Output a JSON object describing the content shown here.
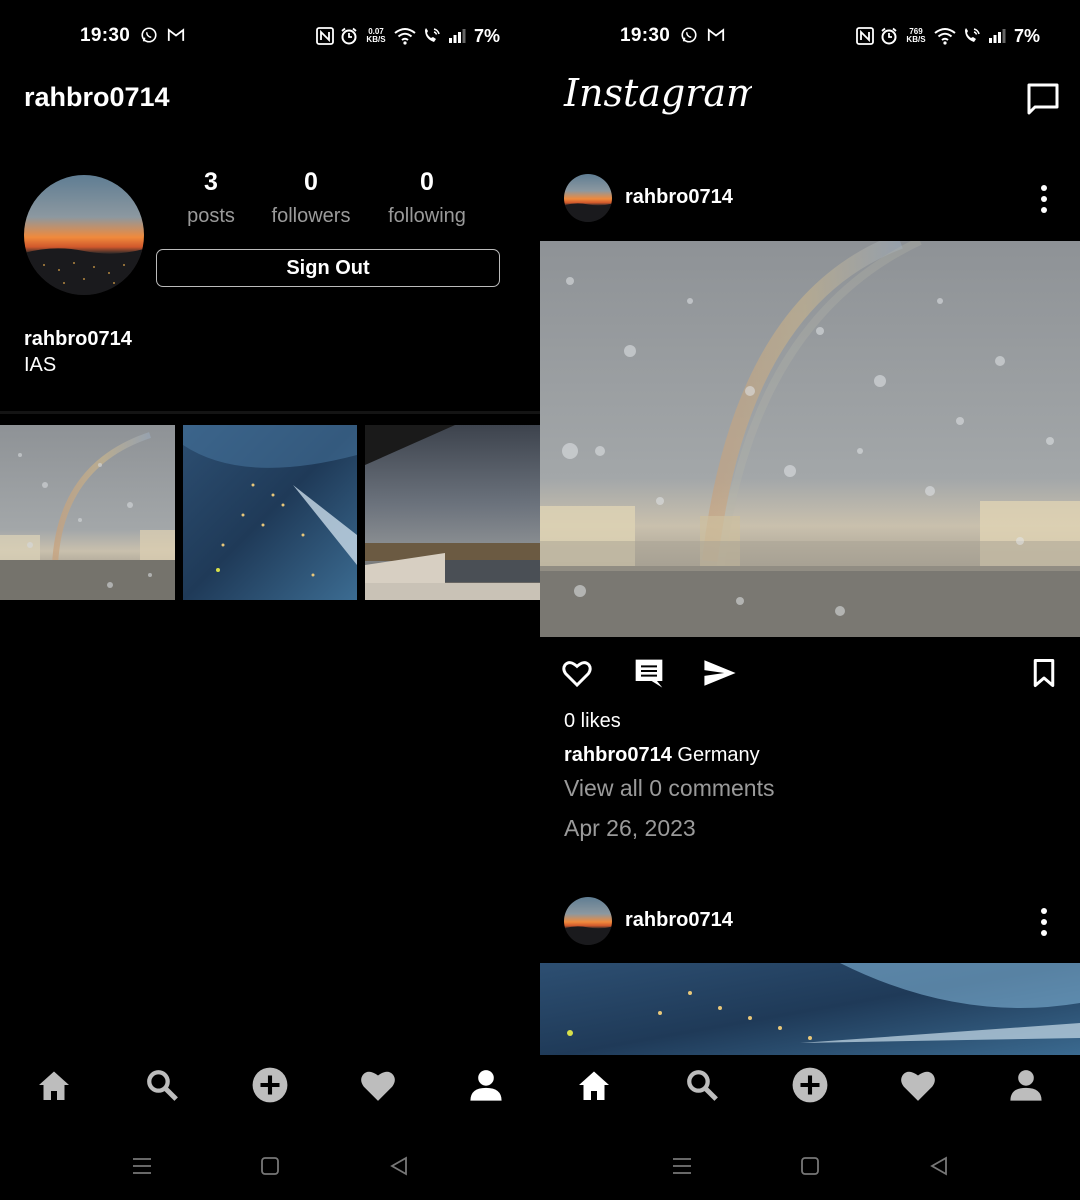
{
  "status_bar": {
    "time": "19:30",
    "left_speed": [
      "0.07",
      "KB/S"
    ],
    "right_speed": [
      "769",
      "KB/S"
    ],
    "battery": "7%"
  },
  "profile": {
    "username": "rahbro0714",
    "stats": {
      "posts_count": "3",
      "posts_label": "posts",
      "followers_count": "0",
      "followers_label": "followers",
      "following_count": "0",
      "following_label": "following"
    },
    "sign_out_label": "Sign Out",
    "bio_name": "rahbro0714",
    "bio_text": "IAS",
    "grid_images": [
      "rainbow-window-photo",
      "aerial-city-night-photo",
      "cloudy-balcony-photo"
    ]
  },
  "feed": {
    "logo_text": "Instagram",
    "posts": [
      {
        "username": "rahbro0714",
        "likes": "0 likes",
        "caption_user": "rahbro0714",
        "caption_text": "Germany",
        "comments_link": "View all 0 comments",
        "date": "Apr 26, 2023"
      },
      {
        "username": "rahbro0714"
      }
    ]
  },
  "bottom_nav": [
    "home-icon",
    "search-icon",
    "add-post-icon",
    "heart-icon",
    "profile-icon"
  ],
  "system_nav": [
    "menu-icon",
    "home-square-icon",
    "back-icon"
  ],
  "colors": {
    "background": "#000000",
    "secondary_text": "#9a9a9a",
    "divider": "#141414"
  }
}
